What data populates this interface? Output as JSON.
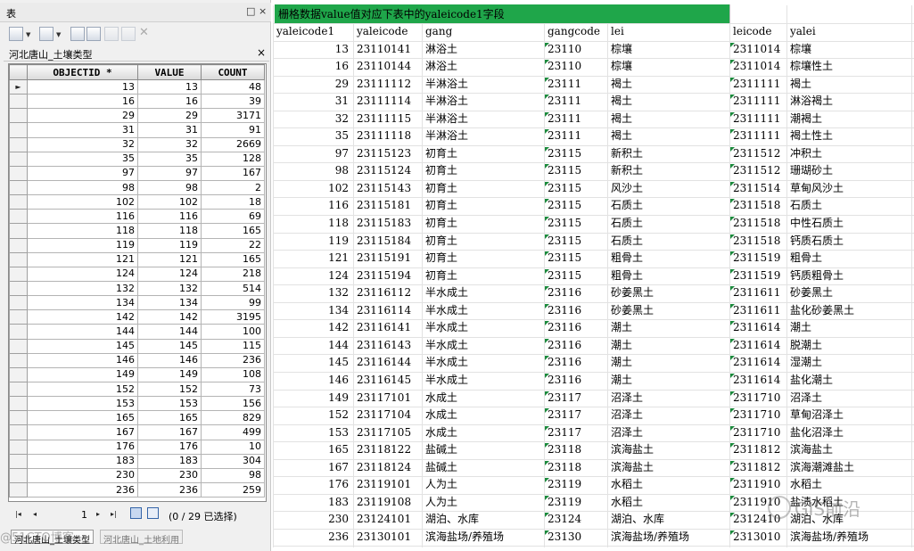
{
  "left_panel": {
    "title": "表",
    "window_controls": [
      "□",
      "×"
    ],
    "tab_label": "河北唐山_土壤类型",
    "tab_close": "×",
    "columns": [
      "OBJECTID *",
      "VALUE",
      "COUNT"
    ],
    "current_row_marker": "►",
    "rows": [
      [
        "13",
        "13",
        "48"
      ],
      [
        "16",
        "16",
        "39"
      ],
      [
        "29",
        "29",
        "3171"
      ],
      [
        "31",
        "31",
        "91"
      ],
      [
        "32",
        "32",
        "2669"
      ],
      [
        "35",
        "35",
        "128"
      ],
      [
        "97",
        "97",
        "167"
      ],
      [
        "98",
        "98",
        "2"
      ],
      [
        "102",
        "102",
        "18"
      ],
      [
        "116",
        "116",
        "69"
      ],
      [
        "118",
        "118",
        "165"
      ],
      [
        "119",
        "119",
        "22"
      ],
      [
        "121",
        "121",
        "165"
      ],
      [
        "124",
        "124",
        "218"
      ],
      [
        "132",
        "132",
        "514"
      ],
      [
        "134",
        "134",
        "99"
      ],
      [
        "142",
        "142",
        "3195"
      ],
      [
        "144",
        "144",
        "100"
      ],
      [
        "145",
        "145",
        "115"
      ],
      [
        "146",
        "146",
        "236"
      ],
      [
        "149",
        "149",
        "108"
      ],
      [
        "152",
        "152",
        "73"
      ],
      [
        "153",
        "153",
        "156"
      ],
      [
        "165",
        "165",
        "829"
      ],
      [
        "167",
        "167",
        "499"
      ],
      [
        "176",
        "176",
        "10"
      ],
      [
        "183",
        "183",
        "304"
      ],
      [
        "230",
        "230",
        "98"
      ],
      [
        "236",
        "236",
        "259"
      ]
    ],
    "nav": {
      "first": "◂◂",
      "prev": "◂",
      "record": "1",
      "next": "▸",
      "last": "▸▸",
      "status": "(0 / 29 已选择)"
    },
    "bottom_tabs": [
      "河北唐山_土壤类型",
      "河北唐山_土地利用"
    ],
    "watermark": "@51CTO博客"
  },
  "sheet": {
    "banner": "栅格数据value值对应下表中的yaleicode1字段",
    "headers": [
      "yaleicode1",
      "yaleicode",
      "gang",
      "gangcode",
      "lei",
      "leicode",
      "yalei"
    ],
    "rows": [
      [
        "13",
        "23110141",
        "淋浴土",
        "23110",
        "棕壤",
        "2311014",
        "棕壤"
      ],
      [
        "16",
        "23110144",
        "淋浴土",
        "23110",
        "棕壤",
        "2311014",
        "棕壤性土"
      ],
      [
        "29",
        "23111112",
        "半淋浴土",
        "23111",
        "褐土",
        "2311111",
        "褐土"
      ],
      [
        "31",
        "23111114",
        "半淋浴土",
        "23111",
        "褐土",
        "2311111",
        "淋浴褐土"
      ],
      [
        "32",
        "23111115",
        "半淋浴土",
        "23111",
        "褐土",
        "2311111",
        "潮褐土"
      ],
      [
        "35",
        "23111118",
        "半淋浴土",
        "23111",
        "褐土",
        "2311111",
        "褐土性土"
      ],
      [
        "97",
        "23115123",
        "初育土",
        "23115",
        "新积土",
        "2311512",
        "冲积土"
      ],
      [
        "98",
        "23115124",
        "初育土",
        "23115",
        "新积土",
        "2311512",
        "珊瑚砂土"
      ],
      [
        "102",
        "23115143",
        "初育土",
        "23115",
        "风沙土",
        "2311514",
        "草甸风沙土"
      ],
      [
        "116",
        "23115181",
        "初育土",
        "23115",
        "石质土",
        "2311518",
        "石质土"
      ],
      [
        "118",
        "23115183",
        "初育土",
        "23115",
        "石质土",
        "2311518",
        "中性石质土"
      ],
      [
        "119",
        "23115184",
        "初育土",
        "23115",
        "石质土",
        "2311518",
        "钙质石质土"
      ],
      [
        "121",
        "23115191",
        "初育土",
        "23115",
        "粗骨土",
        "2311519",
        "粗骨土"
      ],
      [
        "124",
        "23115194",
        "初育土",
        "23115",
        "粗骨土",
        "2311519",
        "钙质粗骨土"
      ],
      [
        "132",
        "23116112",
        "半水成土",
        "23116",
        "砂姜黑土",
        "2311611",
        "砂姜黑土"
      ],
      [
        "134",
        "23116114",
        "半水成土",
        "23116",
        "砂姜黑土",
        "2311611",
        "盐化砂姜黑土"
      ],
      [
        "142",
        "23116141",
        "半水成土",
        "23116",
        "潮土",
        "2311614",
        "潮土"
      ],
      [
        "144",
        "23116143",
        "半水成土",
        "23116",
        "潮土",
        "2311614",
        "脱潮土"
      ],
      [
        "145",
        "23116144",
        "半水成土",
        "23116",
        "潮土",
        "2311614",
        "湿潮土"
      ],
      [
        "146",
        "23116145",
        "半水成土",
        "23116",
        "潮土",
        "2311614",
        "盐化潮土"
      ],
      [
        "149",
        "23117101",
        "水成土",
        "23117",
        "沼泽土",
        "2311710",
        "沼泽土"
      ],
      [
        "152",
        "23117104",
        "水成土",
        "23117",
        "沼泽土",
        "2311710",
        "草甸沼泽土"
      ],
      [
        "153",
        "23117105",
        "水成土",
        "23117",
        "沼泽土",
        "2311710",
        "盐化沼泽土"
      ],
      [
        "165",
        "23118122",
        "盐碱土",
        "23118",
        "滨海盐土",
        "2311812",
        "滨海盐土"
      ],
      [
        "167",
        "23118124",
        "盐碱土",
        "23118",
        "滨海盐土",
        "2311812",
        "滨海潮滩盐土"
      ],
      [
        "176",
        "23119101",
        "人为土",
        "23119",
        "水稻土",
        "2311910",
        "水稻土"
      ],
      [
        "183",
        "23119108",
        "人为土",
        "23119",
        "水稻土",
        "2311910",
        "盐渍水稻土"
      ],
      [
        "230",
        "23124101",
        "湖泊、水库",
        "23124",
        "湖泊、水库",
        "2312410",
        "湖泊、水库"
      ],
      [
        "236",
        "23130101",
        "滨海盐场/养殖场",
        "23130",
        "滨海盐场/养殖场",
        "2313010",
        "滨海盐场/养殖场"
      ]
    ],
    "watermark": "GIS前沿"
  },
  "colors": {
    "banner_green": "#1fa64a",
    "cell_marker_green": "#1b8a3c",
    "panel_gray": "#f0f0f0"
  }
}
